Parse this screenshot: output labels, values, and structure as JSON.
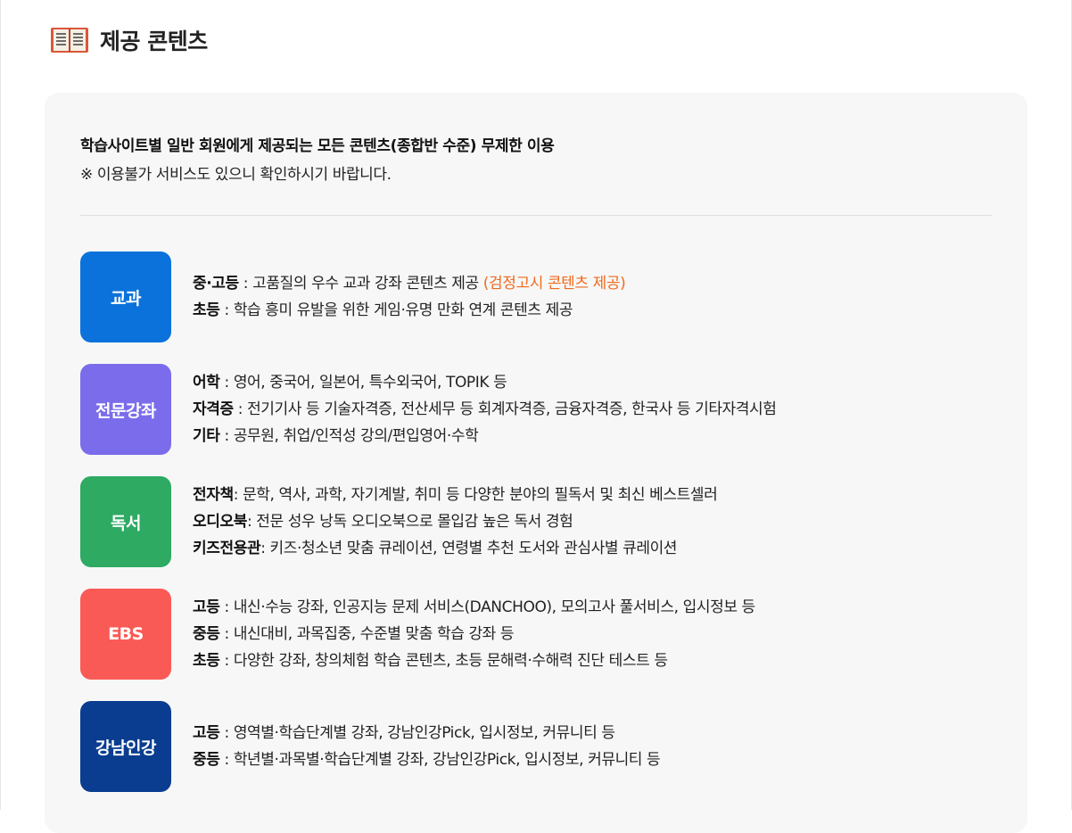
{
  "section": {
    "title": "제공 콘텐츠",
    "icon": "book-icon"
  },
  "intro": {
    "main": "학습사이트별 일반 회원에게 제공되는 모든 콘텐츠(종합반 수준) 무제한 이용",
    "note": "※ 이용불가 서비스도 있으니 확인하시기 바랍니다."
  },
  "colors": {
    "gyogwa": "#0b72db",
    "jeonmun": "#7b6cec",
    "dokseo": "#2eaa63",
    "ebs": "#fa5a55",
    "gangnam": "#0a3d8f",
    "highlight": "#f06a1d"
  },
  "categories": [
    {
      "badge": "교과",
      "lines": [
        {
          "label": "중·고등",
          "text": " : 고품질의 우수 교과 강좌 콘텐츠 제공 ",
          "highlight": "(검정고시 콘텐츠 제공)"
        },
        {
          "label": "초등",
          "text": " : 학습 흥미 유발을 위한 게임·유명 만화 연계 콘텐츠 제공"
        }
      ]
    },
    {
      "badge": "전문강좌",
      "lines": [
        {
          "label": "어학",
          "text": " : 영어, 중국어, 일본어, 특수외국어, TOPIK 등"
        },
        {
          "label": "자격증",
          "text": " : 전기기사 등 기술자격증, 전산세무 등 회계자격증, 금융자격증, 한국사 등 기타자격시험"
        },
        {
          "label": "기타",
          "text": " : 공무원, 취업/인적성 강의/편입영어·수학"
        }
      ]
    },
    {
      "badge": "독서",
      "lines": [
        {
          "label": "전자책",
          "text": ": 문학, 역사, 과학, 자기계발, 취미 등 다양한 분야의 필독서 및 최신 베스트셀러"
        },
        {
          "label": "오디오북",
          "text": ": 전문 성우 낭독 오디오북으로 몰입감 높은 독서 경험"
        },
        {
          "label": "키즈전용관",
          "text": ": 키즈·청소년 맞춤 큐레이션, 연령별 추천 도서와 관심사별 큐레이션"
        }
      ]
    },
    {
      "badge": "EBS",
      "lines": [
        {
          "label": "고등",
          "text": " : 내신·수능 강좌, 인공지능 문제 서비스(DANCHOO), 모의고사 풀서비스, 입시정보 등"
        },
        {
          "label": "중등",
          "text": " : 내신대비, 과목집중, 수준별 맞춤 학습 강좌 등"
        },
        {
          "label": "초등",
          "text": " : 다양한 강좌, 창의체험 학습 콘텐츠, 초등 문해력·수해력 진단 테스트 등"
        }
      ]
    },
    {
      "badge": "강남인강",
      "lines": [
        {
          "label": "고등",
          "text": " : 영역별·학습단계별 강좌, 강남인강Pick, 입시정보, 커뮤니티 등"
        },
        {
          "label": "중등",
          "text": " : 학년별·과목별·학습단계별 강좌, 강남인강Pick, 입시정보, 커뮤니티 등"
        }
      ]
    }
  ]
}
